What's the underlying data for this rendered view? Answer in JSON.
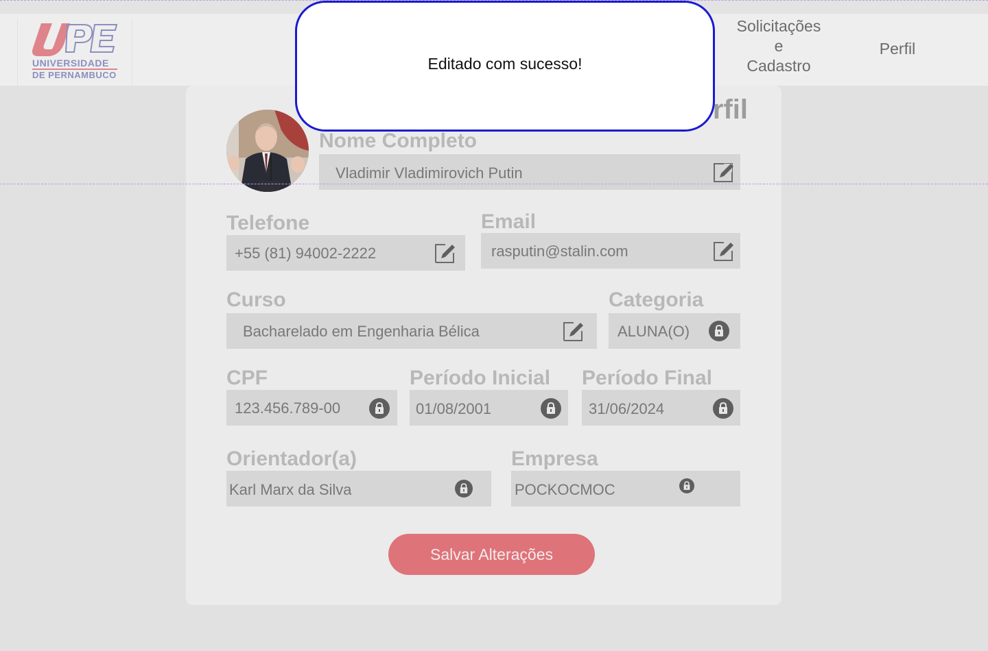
{
  "logo": {
    "line1": "UNIVERSIDADE",
    "line2": "DE PERNAMBUCO",
    "colors": {
      "mark_red": "#de848a",
      "mark_blue": "#8b8fbf"
    }
  },
  "nav": {
    "solicitacoes_line1": "Solicitações",
    "solicitacoes_line2": "e",
    "solicitacoes_line3": "Cadastro",
    "perfil": "Perfil"
  },
  "page": {
    "title_partial": "rfil"
  },
  "form": {
    "nome": {
      "label": "Nome Completo",
      "value": "Vladimir Vladimirovich Putin",
      "icon": "edit-icon"
    },
    "telefone": {
      "label": "Telefone",
      "value": "+55 (81) 94002-2222",
      "icon": "edit-icon"
    },
    "email": {
      "label": "Email",
      "value": "rasputin@stalin.com",
      "icon": "edit-icon"
    },
    "curso": {
      "label": "Curso",
      "value": "Bacharelado em Engenharia Bélica",
      "icon": "edit-icon"
    },
    "categoria": {
      "label": "Categoria",
      "value": "ALUNA(O)",
      "icon": "lock-icon"
    },
    "cpf": {
      "label": "CPF",
      "value": "123.456.789-00",
      "icon": "lock-icon"
    },
    "periodo_inicial": {
      "label": "Período Inicial",
      "value": "01/08/2001",
      "icon": "lock-icon"
    },
    "periodo_final": {
      "label": "Período Final",
      "value": "31/06/2024",
      "icon": "lock-icon"
    },
    "orientador": {
      "label": "Orientador(a)",
      "value": "Karl Marx da Silva",
      "icon": "lock-icon"
    },
    "empresa": {
      "label": "Empresa",
      "value": "POCKOCMOC",
      "icon": "lock-icon"
    }
  },
  "actions": {
    "save_label": "Salvar Alterações"
  },
  "toast": {
    "message": "Editado com sucesso!"
  },
  "colors": {
    "accent": "#de737a",
    "toast_border": "#1a1ad2",
    "card_bg": "#ebebeb",
    "field_bg": "#d6d6d6"
  }
}
